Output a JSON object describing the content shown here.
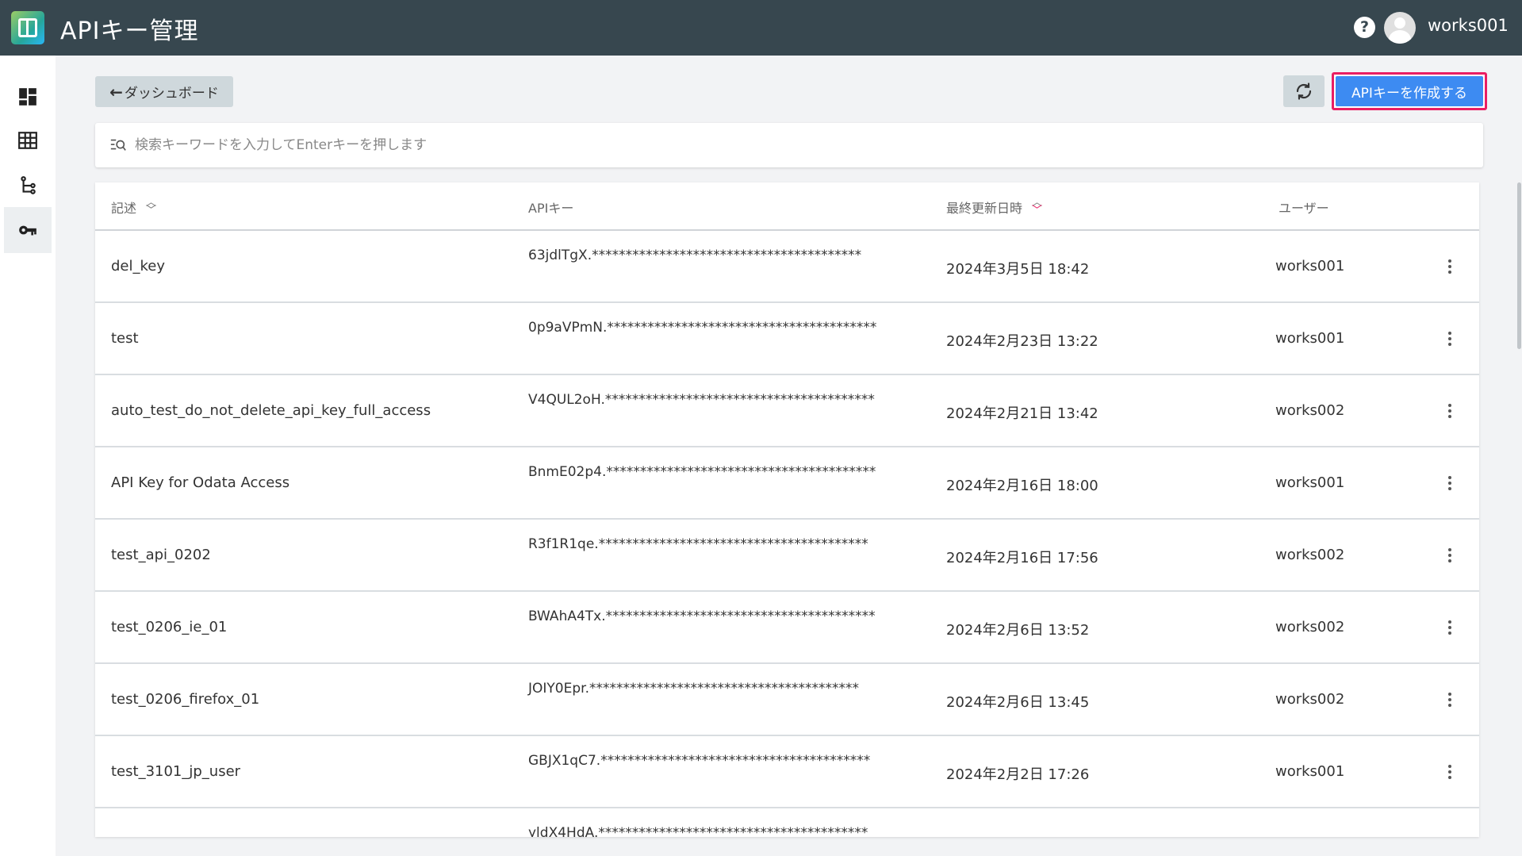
{
  "header": {
    "title": "APIキー管理",
    "help_icon": "?",
    "username": "works001"
  },
  "sidebar": {
    "items": [
      {
        "name": "dashboard-icon"
      },
      {
        "name": "table-icon"
      },
      {
        "name": "tree-icon"
      },
      {
        "name": "key-icon",
        "active": true
      }
    ]
  },
  "toolbar": {
    "back_label": "ダッシュボード",
    "create_label": "APIキーを作成する"
  },
  "search": {
    "placeholder": "検索キーワードを入力してEnterキーを押します"
  },
  "table": {
    "headers": {
      "description": "記述",
      "api_key": "APIキー",
      "updated": "最終更新日時",
      "user": "ユーザー"
    },
    "rows": [
      {
        "description": "del_key",
        "api_key": "63jdlTgX.****************************************",
        "updated": "2024年3月5日 18:42",
        "user": "works001"
      },
      {
        "description": "test",
        "api_key": "0p9aVPmN.****************************************",
        "updated": "2024年2月23日 13:22",
        "user": "works001"
      },
      {
        "description": "auto_test_do_not_delete_api_key_full_access",
        "api_key": "V4QUL2oH.****************************************",
        "updated": "2024年2月21日 13:42",
        "user": "works002"
      },
      {
        "description": "API Key for Odata Access",
        "api_key": "BnmE02p4.****************************************",
        "updated": "2024年2月16日 18:00",
        "user": "works001"
      },
      {
        "description": "test_api_0202",
        "api_key": "R3f1R1qe.****************************************",
        "updated": "2024年2月16日 17:56",
        "user": "works002"
      },
      {
        "description": "test_0206_ie_01",
        "api_key": "BWAhA4Tx.****************************************",
        "updated": "2024年2月6日 13:52",
        "user": "works002"
      },
      {
        "description": "test_0206_firefox_01",
        "api_key": "JOIY0Epr.****************************************",
        "updated": "2024年2月6日 13:45",
        "user": "works002"
      },
      {
        "description": "test_3101_jp_user",
        "api_key": "GBJX1qC7.****************************************",
        "updated": "2024年2月2日 17:26",
        "user": "works001"
      },
      {
        "description": "",
        "api_key": "yldX4HdA.****************************************",
        "updated": "",
        "user": ""
      }
    ]
  },
  "colors": {
    "header_bg": "#37474f",
    "primary": "#3d8bf2",
    "highlight": "#e91e63"
  }
}
